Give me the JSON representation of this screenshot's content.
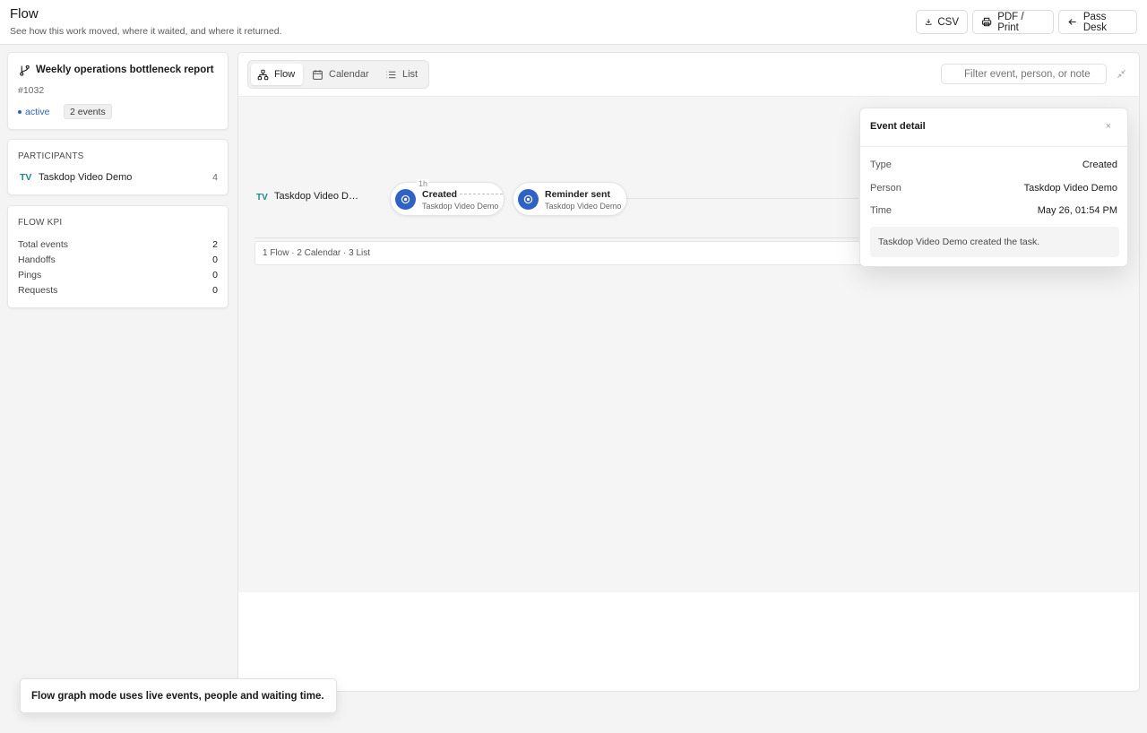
{
  "header": {
    "title": "Flow",
    "subtitle": "See how this work moved, where it waited, and where it returned.",
    "csv_label": "CSV",
    "print_label": "PDF / Print",
    "back_label": "Pass Desk"
  },
  "task": {
    "title": "Weekly operations bottleneck report",
    "id": "#1032",
    "status": "active",
    "events_badge": "2 events"
  },
  "participants": {
    "heading": "PARTICIPANTS",
    "items": [
      {
        "initials": "TV",
        "name": "Taskdop Video Demo",
        "count": "4"
      }
    ]
  },
  "kpi": {
    "heading": "FLOW KPI",
    "rows": [
      {
        "label": "Total events",
        "value": "2"
      },
      {
        "label": "Handoffs",
        "value": "0"
      },
      {
        "label": "Pings",
        "value": "0"
      },
      {
        "label": "Requests",
        "value": "0"
      }
    ]
  },
  "view_tabs": [
    {
      "label": "Flow",
      "active": true
    },
    {
      "label": "Calendar",
      "active": false
    },
    {
      "label": "List",
      "active": false
    }
  ],
  "search": {
    "placeholder": "Filter event, person, or note"
  },
  "lane": {
    "initials": "TV",
    "name": "Taskdop Video Demo"
  },
  "nodes": [
    {
      "title": "Created",
      "person": "Taskdop Video Demo"
    },
    {
      "title": "Reminder sent",
      "person": "Taskdop Video Demo"
    }
  ],
  "duration_label": "1h",
  "counts_bar": "1 Flow · 2 Calendar · 3 List",
  "detail": {
    "title": "Event detail",
    "close": "×",
    "rows": [
      {
        "label": "Type",
        "value": "Created"
      },
      {
        "label": "Person",
        "value": "Taskdop Video Demo"
      },
      {
        "label": "Time",
        "value": "May 26, 01:54 PM"
      }
    ],
    "note": "Taskdop Video Demo created the task."
  },
  "toast": "Flow graph mode uses live events, people and waiting time.",
  "colors": {
    "accent": "#2f62c8",
    "teal": "#1b8a8a"
  }
}
